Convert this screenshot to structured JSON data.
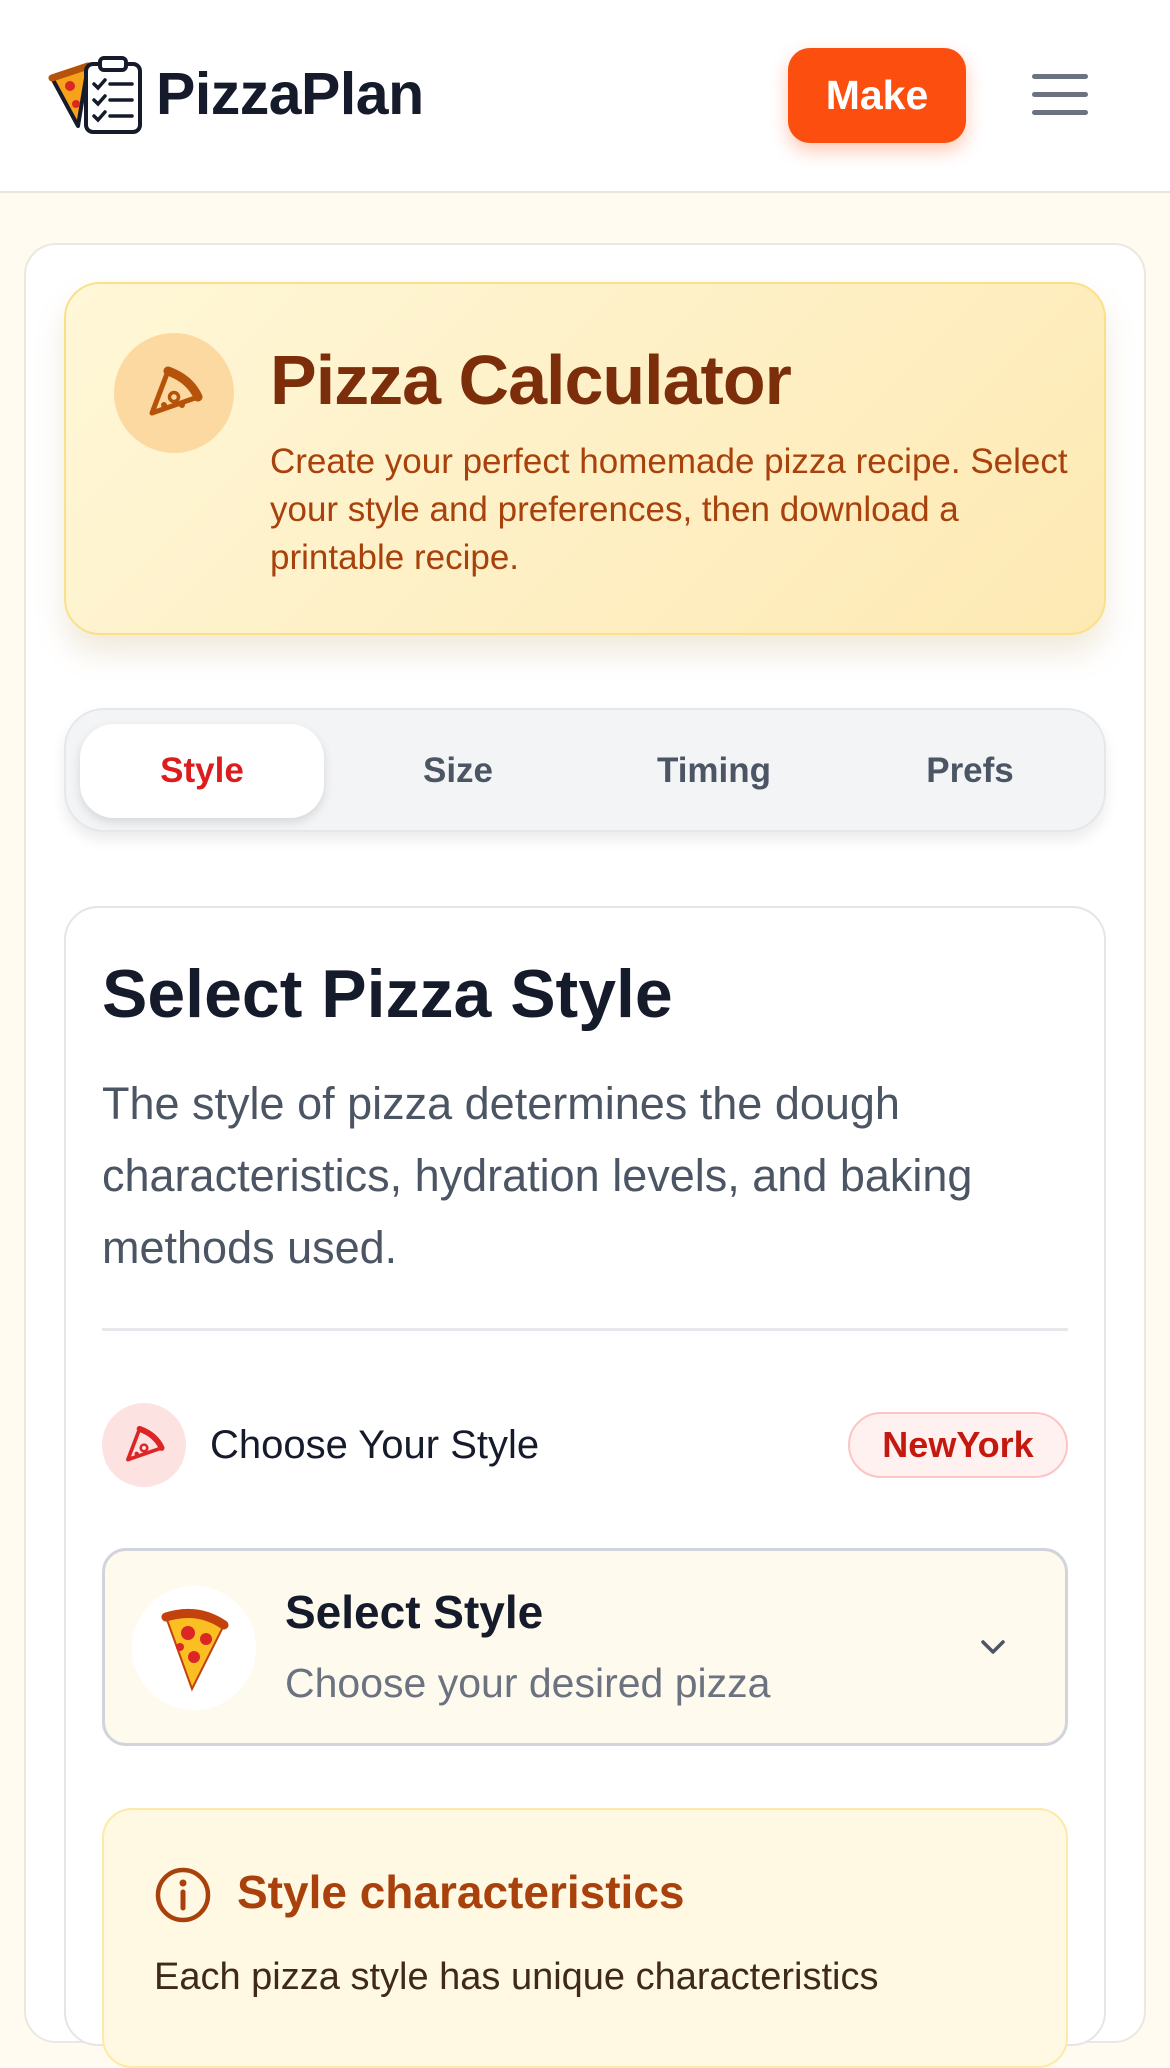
{
  "header": {
    "brand": "PizzaPlan",
    "make_label": "Make"
  },
  "hero": {
    "title": "Pizza Calculator",
    "description": "Create your perfect homemade pizza recipe. Select your style and preferences, then download a printable recipe."
  },
  "tabs": [
    {
      "label": "Style",
      "active": true
    },
    {
      "label": "Size",
      "active": false
    },
    {
      "label": "Timing",
      "active": false
    },
    {
      "label": "Prefs",
      "active": false
    }
  ],
  "section": {
    "title": "Select Pizza Style",
    "description": "The style of pizza determines the dough characteristics, hydration levels, and baking methods used.",
    "choose_label": "Choose Your Style",
    "selected_badge": "NewYork"
  },
  "select": {
    "title": "Select Style",
    "subtitle": "Choose your desired pizza",
    "icon": "pizza-slice-emoji"
  },
  "info": {
    "title": "Style characteristics",
    "text": "Each pizza style has unique characteristics"
  },
  "colors": {
    "accent": "#fb4e0f",
    "active_tab": "#dc1d1d",
    "hero_title": "#7c2d0a"
  }
}
